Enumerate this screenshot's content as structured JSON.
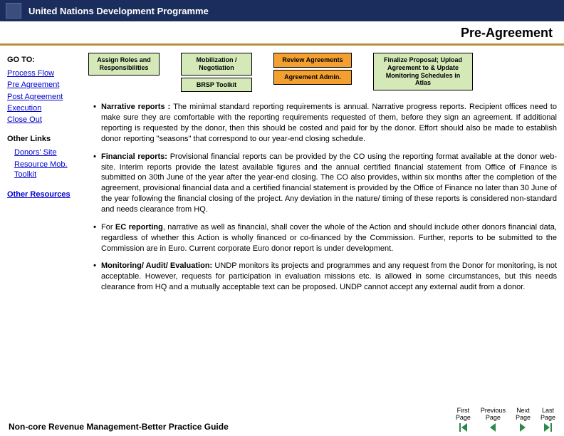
{
  "header": {
    "org": "United Nations Development Programme"
  },
  "title": "Pre-Agreement",
  "sidebar": {
    "goto_label": "GO TO:",
    "links": {
      "process_flow": "Process Flow",
      "pre_agreement": "Pre Agreement",
      "post_agreement": "Post Agreement",
      "execution": "Execution",
      "close_out": "Close Out"
    },
    "other_links_label": "Other Links",
    "other_links": {
      "donors_site": "Donors' Site",
      "resource_mob": "Resource Mob. Toolkit"
    },
    "other_resources_label": "Other Resources"
  },
  "flow": {
    "box1": "Assign Roles and Responsibilities",
    "box2a": "Mobilization / Negotiation",
    "box2b": "BRSP Toolkit",
    "box3a": "Review Agreements",
    "box3b": "Agreement Admin.",
    "box4": "Finalize Proposal; Upload Agreement to & Update Monitoring Schedules in Atlas"
  },
  "bullets": {
    "b1_title": "Narrative reports : ",
    "b1_text": "The minimal standard reporting requirements is annual. Narrative progress reports. Recipient offices need to make sure they are comfortable with the reporting requirements requested of them, before they sign an agreement. If additional reporting is requested by the donor, then this should be costed and paid for by the donor. Effort should also be made to establish donor reporting \"seasons\" that correspond to our year-end closing schedule.",
    "b2_title": "Financial reports: ",
    "b2_text": "Provisional financial reports can be provided by the CO using the reporting format available at the donor web-site. Interim reports provide the latest available figures and the annual certified financial statement from Office of Finance is submitted on 30th June of the year after the year-end closing. The CO also provides, within six months after the completion of the agreement, provisional financial data and a certified financial statement is provided by the Office of Finance no later than 30 June of the year following the financial closing of the project. Any deviation in the nature/ timing of these reports is considered non-standard and needs clearance from HQ.",
    "b3_pre": "For ",
    "b3_title": "EC reporting",
    "b3_text": ", narrative as well as financial, shall cover the whole of the Action and should include other donors financial data, regardless of whether this Action is wholly financed or co-financed by the Commission. Further, reports to be submitted to the Commission are in Euro. Current corporate Euro donor report is under development.",
    "b4_title": "Monitoring/ Audit/ Evaluation: ",
    "b4_text": "UNDP monitors its projects and programmes and any request from the Donor for monitoring, is not acceptable. However, requests for participation in evaluation missions etc. is allowed in some circumstances, but this needs clearance from HQ and a mutually acceptable text can be proposed. UNDP cannot accept any external audit from a donor."
  },
  "footer": {
    "title": "Non-core Revenue Management-Better Practice Guide",
    "nav": {
      "first1": "First",
      "first2": "Page",
      "prev1": "Previous",
      "prev2": "Page",
      "next1": "Next",
      "next2": "Page",
      "last1": "Last",
      "last2": "Page"
    }
  }
}
